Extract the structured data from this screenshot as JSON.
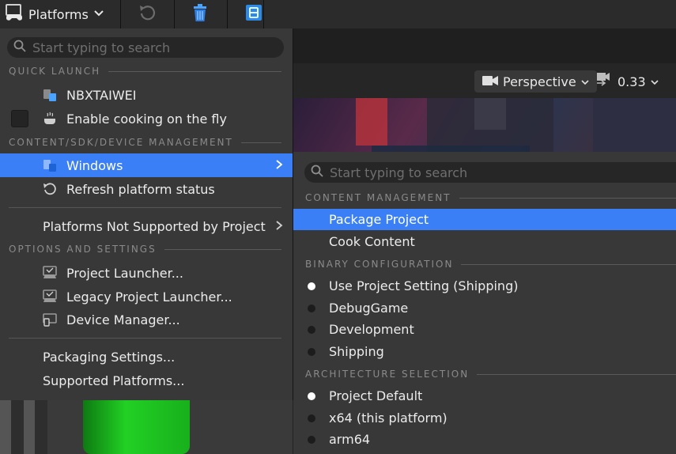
{
  "toolbar": {
    "platforms_label": "Platforms",
    "icons": [
      "gamepad-monitor-icon",
      "undo-icon",
      "trash-icon",
      "blueprint-icon"
    ]
  },
  "viewport": {
    "perspective_label": "Perspective",
    "scale_value": "0.33"
  },
  "menu": {
    "search_placeholder": "Start typing to search",
    "sections": {
      "quick_launch": "QUICK LAUNCH",
      "content_sdk": "CONTENT/SDK/DEVICE MANAGEMENT",
      "options": "OPTIONS AND SETTINGS"
    },
    "items": {
      "nbxtaiwei": "NBXTAIWEI",
      "enable_cooking": "Enable cooking on the fly",
      "windows": "Windows",
      "refresh": "Refresh platform status",
      "not_supported": "Platforms Not Supported by Project",
      "project_launcher": "Project Launcher...",
      "legacy_launcher": "Legacy Project Launcher...",
      "device_manager": "Device Manager...",
      "packaging_settings": "Packaging Settings...",
      "supported_platforms": "Supported Platforms..."
    }
  },
  "submenu": {
    "search_placeholder": "Start typing to search",
    "sections": {
      "content_management": "CONTENT MANAGEMENT",
      "binary_configuration": "BINARY CONFIGURATION",
      "architecture_selection": "ARCHITECTURE SELECTION"
    },
    "items": {
      "package_project": "Package Project",
      "cook_content": "Cook Content",
      "use_project_setting": "Use Project Setting (Shipping)",
      "debuggame": "DebugGame",
      "development": "Development",
      "shipping": "Shipping",
      "project_default": "Project Default",
      "x64": "x64 (this platform)",
      "arm64": "arm64"
    }
  },
  "colors": {
    "highlight": "#3a7ff5",
    "menu_bg": "#383838"
  }
}
